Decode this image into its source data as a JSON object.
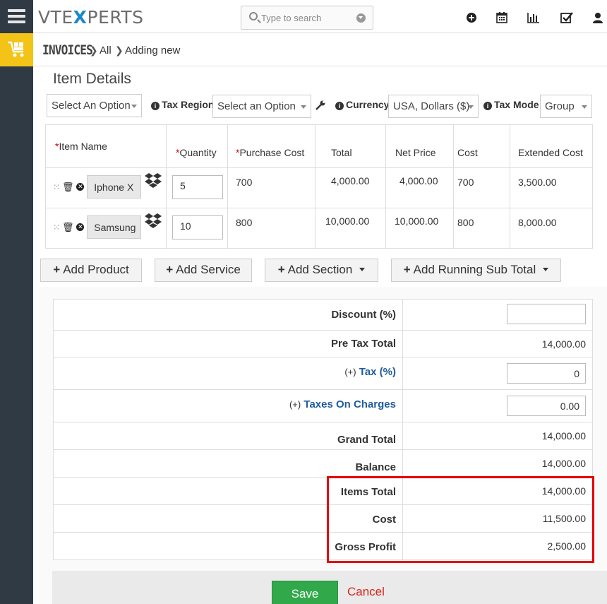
{
  "app": {
    "logo_text_left": "VTE",
    "logo_text_x": "X",
    "logo_text_right": "PERTS"
  },
  "search": {
    "placeholder": "Type to search"
  },
  "breadcrumb": {
    "module": "INVOICES",
    "all": "All",
    "current": "Adding new"
  },
  "section_title": "Item Details",
  "options": {
    "select_option": "Select An Option",
    "tax_region_label": "Tax Region",
    "tax_region_value": "Select an Option",
    "currency_label": "Currency",
    "currency_value": "USA, Dollars ($)",
    "tax_mode_label": "Tax Mode",
    "tax_mode_value": "Group"
  },
  "items_table": {
    "headers": [
      "Item Name",
      "Quantity",
      "Purchase Cost",
      "Total",
      "Net Price",
      "Cost",
      "Extended Cost"
    ],
    "rows": [
      {
        "name": "Iphone X",
        "quantity": "5",
        "purchase_cost": "700",
        "total": "4,000.00",
        "net_price": "4,000.00",
        "cost": "700",
        "extended_cost": "3,500.00"
      },
      {
        "name": "Samsung",
        "quantity": "10",
        "purchase_cost": "800",
        "total": "10,000.00",
        "net_price": "10,000.00",
        "cost": "800",
        "extended_cost": "8,000.00"
      }
    ]
  },
  "buttons": {
    "add_product": "Add Product",
    "add_service": "Add Service",
    "add_section": "Add Section",
    "add_running_sub_total": "Add Running Sub Total",
    "save": "Save",
    "cancel": "Cancel"
  },
  "totals": {
    "discount_label": "Discount (%)",
    "discount_value": "",
    "pre_tax_total_label": "Pre Tax Total",
    "pre_tax_total_value": "14,000.00",
    "tax_prefix": "(+)",
    "tax_label": "Tax (%)",
    "tax_value": "0",
    "charges_prefix": "(+)",
    "charges_label": "Taxes On Charges",
    "charges_value": "0.00",
    "grand_total_label": "Grand Total",
    "grand_total_value": "14,000.00",
    "balance_label": "Balance",
    "balance_value": "14,000.00",
    "items_total_label": "Items Total",
    "items_total_value": "14,000.00",
    "cost_label": "Cost",
    "cost_value": "11,500.00",
    "gross_profit_label": "Gross Profit",
    "gross_profit_value": "2,500.00"
  },
  "colors": {
    "rail": "#2f3a44",
    "module_accent": "#f3c317",
    "brand_blue": "#1b8ac8",
    "save_green": "#31a94a",
    "cancel_red": "#d9241f",
    "highlight_red": "#e30000"
  },
  "icons": [
    "menu-icon",
    "cart-icon",
    "search-icon",
    "plus-circle-icon",
    "calendar-icon",
    "bar-chart-icon",
    "checkbox-icon",
    "user-icon",
    "wrench-icon",
    "info-icon",
    "drag-handle-icon",
    "trash-icon",
    "remove-icon",
    "dropbox-icon"
  ]
}
